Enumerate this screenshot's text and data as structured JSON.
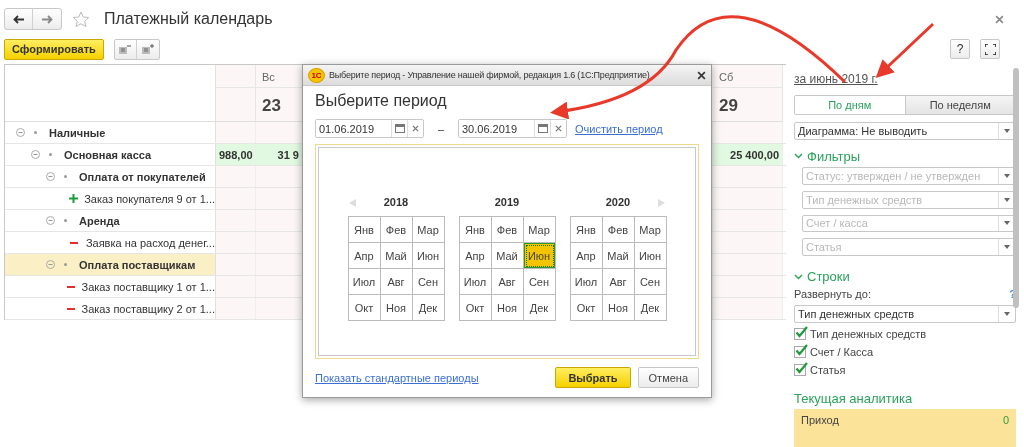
{
  "window": {
    "title": "Платежный календарь",
    "favorite": false
  },
  "toolbar": {
    "generate_button": "Сформировать",
    "help_button": "?"
  },
  "report": {
    "columns": [
      {},
      {
        "weekday": "Вс",
        "day": "23"
      },
      {
        "weekday": "Сб",
        "day": "29"
      }
    ],
    "rows": [
      {
        "label": "Наличные",
        "kind": "group",
        "expanded": true,
        "selected": false,
        "totals": false,
        "children": [
          {
            "label": "Основная касса",
            "kind": "group",
            "expanded": true,
            "selected": false,
            "totals": true,
            "values": [
              "988,00",
              "31 9",
              "25 400,00"
            ],
            "children": [
              {
                "label": "Оплата от покупателей",
                "kind": "group",
                "expanded": true,
                "selected": false,
                "totals": false,
                "children": [
                  {
                    "label": "Заказ покупателя 9 от 1...",
                    "kind": "income",
                    "selected": false,
                    "totals": false
                  }
                ]
              },
              {
                "label": "Аренда",
                "kind": "group",
                "expanded": true,
                "selected": false,
                "totals": false,
                "children": [
                  {
                    "label": "Заявка на расход денег...",
                    "kind": "expense",
                    "selected": false,
                    "totals": false
                  }
                ]
              },
              {
                "label": "Оплата поставщикам",
                "kind": "group",
                "expanded": true,
                "selected": true,
                "totals": false,
                "children": [
                  {
                    "label": "Заказ поставщику 1 от 1...",
                    "kind": "expense",
                    "selected": false,
                    "totals": false
                  },
                  {
                    "label": "Заказ поставщику 2 от 1...",
                    "kind": "expense",
                    "selected": false,
                    "totals": false
                  }
                ]
              }
            ]
          }
        ]
      }
    ]
  },
  "dialog": {
    "logo": "1С",
    "window_title": "Выберите период - Управление нашей фирмой, редакция 1.6  (1С:Предприятие)",
    "heading": "Выберите период",
    "start_date": "01.06.2019",
    "separator": "–",
    "end_date": "30.06.2019",
    "clear_link": "Очистить период",
    "years": [
      {
        "year": "2018",
        "months": [
          {
            "label": "Янв",
            "selected": false
          },
          {
            "label": "Фев",
            "selected": false
          },
          {
            "label": "Мар",
            "selected": false
          },
          {
            "label": "Апр",
            "selected": false
          },
          {
            "label": "Май",
            "selected": false
          },
          {
            "label": "Июн",
            "selected": false
          },
          {
            "label": "Июл",
            "selected": false
          },
          {
            "label": "Авг",
            "selected": false
          },
          {
            "label": "Сен",
            "selected": false
          },
          {
            "label": "Окт",
            "selected": false
          },
          {
            "label": "Ноя",
            "selected": false
          },
          {
            "label": "Дек",
            "selected": false
          }
        ]
      },
      {
        "year": "2019",
        "months": [
          {
            "label": "Янв",
            "selected": false
          },
          {
            "label": "Фев",
            "selected": false
          },
          {
            "label": "Мар",
            "selected": false
          },
          {
            "label": "Апр",
            "selected": false
          },
          {
            "label": "Май",
            "selected": false
          },
          {
            "label": "Июн",
            "selected": true
          },
          {
            "label": "Июл",
            "selected": false
          },
          {
            "label": "Авг",
            "selected": false
          },
          {
            "label": "Сен",
            "selected": false
          },
          {
            "label": "Окт",
            "selected": false
          },
          {
            "label": "Ноя",
            "selected": false
          },
          {
            "label": "Дек",
            "selected": false
          }
        ]
      },
      {
        "year": "2020",
        "months": [
          {
            "label": "Янв",
            "selected": false
          },
          {
            "label": "Фев",
            "selected": false
          },
          {
            "label": "Мар",
            "selected": false
          },
          {
            "label": "Апр",
            "selected": false
          },
          {
            "label": "Май",
            "selected": false
          },
          {
            "label": "Июн",
            "selected": false
          },
          {
            "label": "Июл",
            "selected": false
          },
          {
            "label": "Авг",
            "selected": false
          },
          {
            "label": "Сен",
            "selected": false
          },
          {
            "label": "Окт",
            "selected": false
          },
          {
            "label": "Ноя",
            "selected": false
          },
          {
            "label": "Дек",
            "selected": false
          }
        ]
      }
    ],
    "standard_link": "Показать стандартные периоды",
    "ok_button": "Выбрать",
    "cancel_button": "Отмена"
  },
  "panel": {
    "period_link": "за июнь 2019 г.",
    "view_tabs": [
      {
        "label": "По дням",
        "selected": true
      },
      {
        "label": "По неделям",
        "selected": false
      }
    ],
    "chart_select": "Диаграмма: Не выводить",
    "filters": {
      "title": "Фильтры",
      "expanded": true,
      "fields": [
        {
          "placeholder": "Статус: утвержден / не утвержден"
        },
        {
          "placeholder": "Тип денежных средств"
        },
        {
          "placeholder": "Счет / касса"
        },
        {
          "placeholder": "Статья"
        }
      ]
    },
    "rows_section": {
      "title": "Строки",
      "expanded": true,
      "expand_label": "Развернуть до:",
      "help": "?",
      "expand_select": "Тип денежных средств",
      "options": [
        {
          "label": "Тип денежных средств",
          "checked": true
        },
        {
          "label": "Счет / Касса",
          "checked": true
        },
        {
          "label": "Статья",
          "checked": true
        }
      ]
    },
    "analytics": {
      "title": "Текущая аналитика",
      "items": [
        {
          "label": "Приход",
          "value": "0"
        }
      ]
    }
  }
}
